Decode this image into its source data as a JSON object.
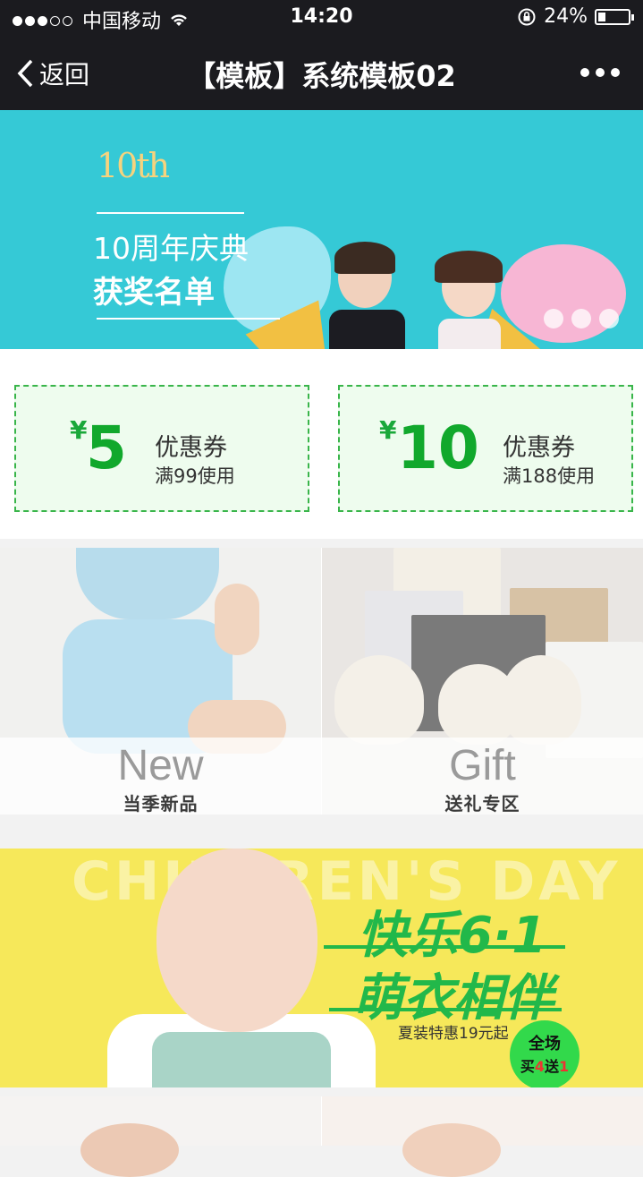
{
  "status_bar": {
    "carrier": "中国移动",
    "time": "14:20",
    "battery_percent": "24%",
    "battery_level": 0.24
  },
  "nav": {
    "back_label": "返回",
    "title": "【模板】系统模板02"
  },
  "banner1": {
    "logo_text": "10th",
    "line1": "10周年庆典",
    "line2": "获奖名单",
    "slide_count": 3
  },
  "coupons": [
    {
      "symbol": "¥",
      "amount": "5",
      "label": "优惠券",
      "condition": "满99使用"
    },
    {
      "symbol": "¥",
      "amount": "10",
      "label": "优惠券",
      "condition": "满188使用"
    }
  ],
  "tiles": [
    {
      "en": "New",
      "cn": "当季新品"
    },
    {
      "en": "Gift",
      "cn": "送礼专区"
    }
  ],
  "banner2": {
    "bg_text": "CHILDREN'S DAY",
    "headline1": "快乐6·1",
    "headline2": "萌衣相伴",
    "subtitle": "夏装特惠19元起",
    "badge_line1": "全场",
    "badge_buy": "买",
    "badge_n1": "4",
    "badge_send": "送",
    "badge_n2": "1"
  },
  "colors": {
    "nav_bg": "#1b1b1f",
    "coupon_green": "#11a82c",
    "banner1_bg": "#35c9d6",
    "banner2_bg": "#f6e85a"
  }
}
